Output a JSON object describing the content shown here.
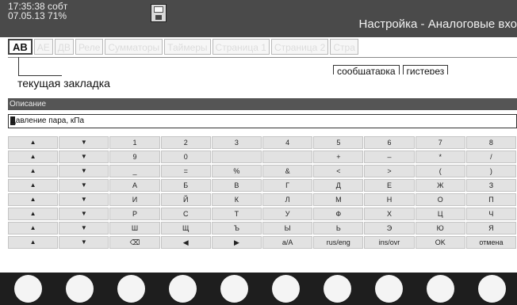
{
  "status": {
    "line1": "17:35:38 собт",
    "line2": "07.05.13 71%"
  },
  "window_title": "Настройка - Аналоговые вхо",
  "tabs": [
    "АВ",
    "АЕ",
    "ДВ",
    "Реле",
    "Сумматоры",
    "Таймеры",
    "Страница 1",
    "Страница 2",
    "Стра"
  ],
  "sub_tabs": [
    "сообщатарка",
    "гистерез"
  ],
  "callout": "текущая закладка",
  "description_header": "Описание",
  "description_value": "Давление пара, кПа",
  "keyboard": {
    "rows": [
      [
        "▲",
        "▼",
        "1",
        "2",
        "3",
        "4",
        "5",
        "6",
        "7",
        "8"
      ],
      [
        "▲",
        "▼",
        "9",
        "0",
        "",
        "",
        "+",
        "–",
        "*",
        "/"
      ],
      [
        "▲",
        "▼",
        "_",
        "=",
        "%",
        "&",
        "<",
        ">",
        "(",
        ")"
      ],
      [
        "▲",
        "▼",
        "А",
        "Б",
        "В",
        "Г",
        "Д",
        "Е",
        "Ж",
        "З"
      ],
      [
        "▲",
        "▼",
        "И",
        "Й",
        "К",
        "Л",
        "М",
        "Н",
        "О",
        "П"
      ],
      [
        "▲",
        "▼",
        "Р",
        "С",
        "Т",
        "У",
        "Ф",
        "Х",
        "Ц",
        "Ч"
      ],
      [
        "▲",
        "▼",
        "Ш",
        "Щ",
        "Ъ",
        "Ы",
        "Ь",
        "Э",
        "Ю",
        "Я"
      ],
      [
        "▲",
        "▼",
        "⌫",
        "◀",
        "▶",
        "а/А",
        "rus/eng",
        "ins/ovr",
        "OK",
        "отмена"
      ]
    ]
  },
  "softkeys_count": 10
}
